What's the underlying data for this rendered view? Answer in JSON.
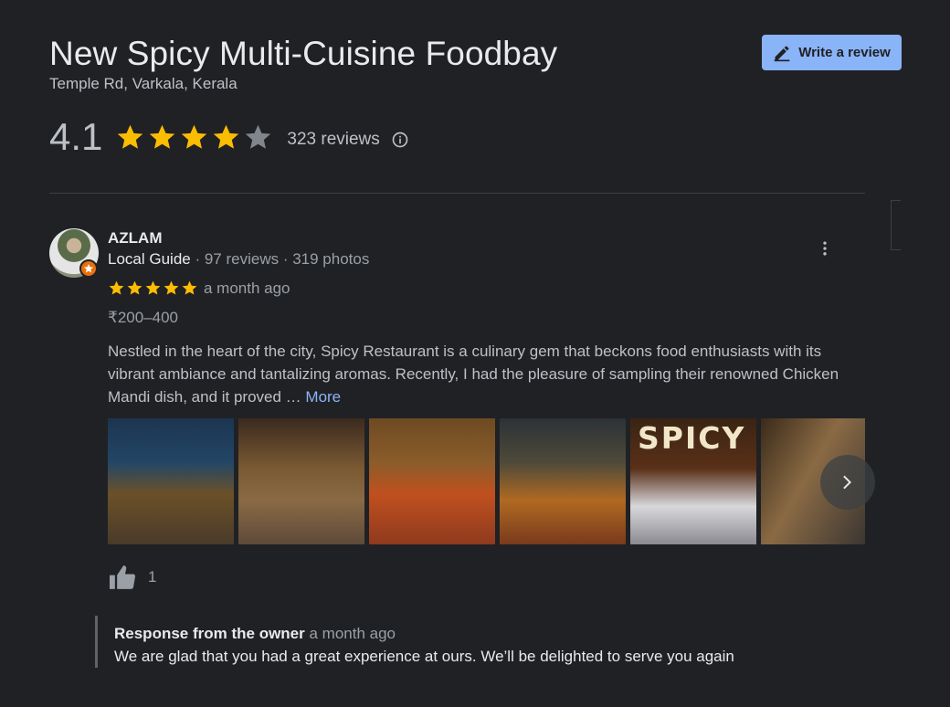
{
  "place": {
    "name": "New Spicy Multi-Cuisine Foodbay",
    "address": "Temple Rd, Varkala, Kerala",
    "rating": "4.1",
    "rating_stars": 4,
    "review_count": "323 reviews"
  },
  "write_review": {
    "label": "Write a review"
  },
  "review": {
    "author": "AZLAM",
    "author_badge": "Local Guide",
    "author_stats": " · 97 reviews · 319 photos",
    "stars": 5,
    "time": "a month ago",
    "price": "₹200–400",
    "text": "Nestled in the heart of the city, Spicy Restaurant is a culinary gem that beckons food enthusiasts with its vibrant ambiance and tantalizing aromas. Recently, I had the pleasure of sampling their renowned Chicken Mandi dish, and it proved … ",
    "more_label": "More",
    "photo_sign": "SPICY",
    "likes": "1"
  },
  "owner_response": {
    "label": "Response from the owner",
    "time": "a month ago",
    "text": "We are glad that you had a great experience at ours. We’ll be delighted to serve you again"
  },
  "colors": {
    "accent": "#8ab4f8",
    "star": "#fbbc04",
    "background": "#202124"
  },
  "icons": [
    "pencil-icon",
    "star-icon",
    "info-icon",
    "more-vert-icon",
    "local-guide-badge-icon",
    "chevron-right-icon",
    "thumb-up-icon"
  ]
}
